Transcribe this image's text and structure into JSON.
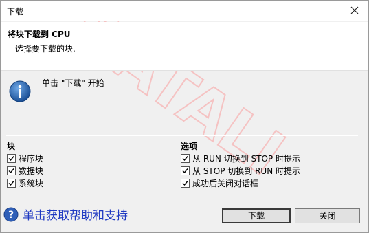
{
  "window": {
    "title": "下载"
  },
  "header": {
    "heading": "将块下载到 CPU",
    "subheading": "选择要下载的块."
  },
  "info": {
    "message": "单击 \"下载\" 开始"
  },
  "blocks_group": {
    "title": "块",
    "items": [
      {
        "label": "程序块",
        "checked": true
      },
      {
        "label": "数据块",
        "checked": true
      },
      {
        "label": "系统块",
        "checked": true
      }
    ]
  },
  "options_group": {
    "title": "选项",
    "items": [
      {
        "label": "从 RUN 切换到 STOP 时提示",
        "checked": true
      },
      {
        "label": "从 STOP 切换到 RUN 时提示",
        "checked": true
      },
      {
        "label": "成功后关闭对话框",
        "checked": true
      }
    ]
  },
  "help": {
    "label": "单击获取帮助和支持",
    "icon": "help-icon"
  },
  "buttons": {
    "download": "下载",
    "close": "关闭"
  },
  "watermark": {
    "text": "DATALI"
  },
  "colors": {
    "help_link": "#1f39c2",
    "info_icon": "#1f5fa8",
    "watermark": "#f7c9c9"
  }
}
